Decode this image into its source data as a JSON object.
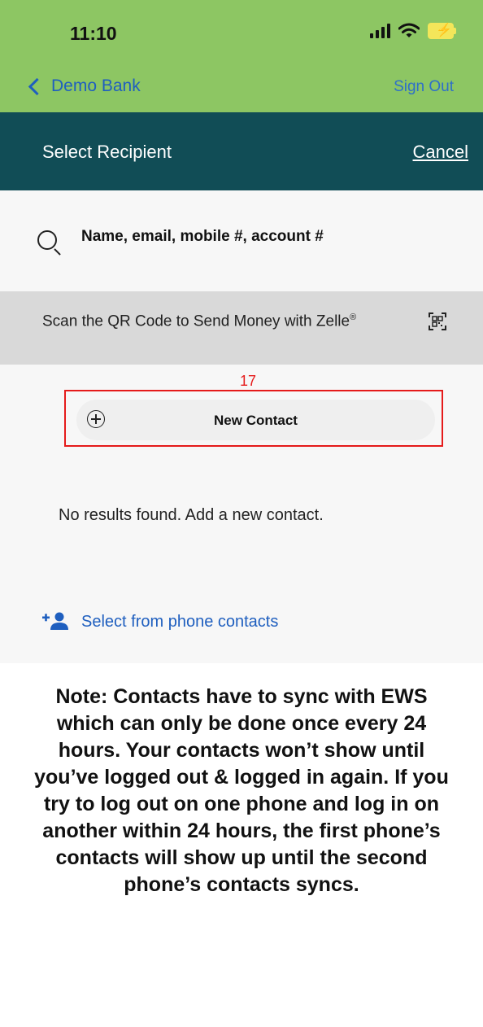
{
  "status_bar": {
    "time": "11:10",
    "icons": [
      "signal-icon",
      "wifi-icon",
      "battery-charging-icon"
    ]
  },
  "nav": {
    "back_label": "Demo Bank",
    "sign_out_label": "Sign Out"
  },
  "header": {
    "title": "Select Recipient",
    "cancel_label": "Cancel"
  },
  "search": {
    "placeholder": "Name, email, mobile #, account #"
  },
  "qr_bar": {
    "text": "Scan the QR Code to Send Money with Zelle",
    "registered_mark": "®",
    "icon": "qr-code-icon"
  },
  "new_contact": {
    "annotation_number": "17",
    "label": "New Contact",
    "icon": "plus-circle-icon"
  },
  "empty_state": {
    "message": "No results found. Add a new contact."
  },
  "phone_contacts": {
    "label": "Select from phone contacts",
    "icon": "add-person-icon"
  },
  "note": {
    "text": "Note: Contacts have to sync with EWS which can only be done once every 24 hours. Your contacts won’t show until you’ve logged out & logged in again. If you try to log out on one phone and log in on another within 24 hours, the first phone’s contacts will show up until the second phone’s contacts syncs."
  },
  "colors": {
    "status_bar": "#8dc663",
    "header": "#114d56",
    "link_blue": "#1f5fbf",
    "highlight_red": "#e51b1b"
  }
}
